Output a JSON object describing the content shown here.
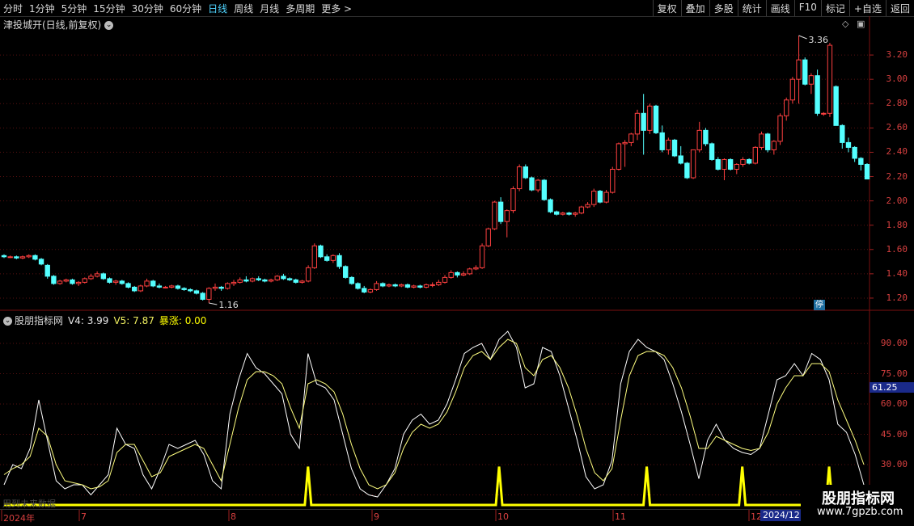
{
  "toolbar": {
    "periods": [
      "分时",
      "1分钟",
      "5分钟",
      "15分钟",
      "30分钟",
      "60分钟",
      "日线",
      "周线",
      "月线",
      "多周期",
      "更多 >"
    ],
    "active_period": "日线",
    "right_buttons": [
      "复权",
      "叠加",
      "多股",
      "统计",
      "画线",
      "F10",
      "标记",
      "+自选",
      "返回"
    ]
  },
  "price_panel": {
    "title": "津投城开(日线,前复权)",
    "y_ticks": [
      "3.20",
      "3.00",
      "2.80",
      "2.60",
      "2.40",
      "2.20",
      "2.00",
      "1.80",
      "1.60",
      "1.40",
      "1.20"
    ],
    "high_label": "3.36",
    "low_label": "1.16",
    "stop_badge": "停"
  },
  "indicator_panel": {
    "title": "股朋指标网",
    "v4_label": "V4: 3.99",
    "v5_label": "V5: 7.87",
    "bz_label": "暴涨: 0.00",
    "y_ticks": [
      "90.00",
      "75.00",
      "60.00",
      "45.00",
      "30.00",
      "15.00"
    ],
    "current_value": "61.25",
    "future_text": "用到未来数据"
  },
  "date_axis": {
    "labels": [
      "2024年",
      "7",
      "8",
      "9",
      "10",
      "11",
      "12"
    ],
    "selected": "2024/12"
  },
  "watermark": {
    "name": "股朋指标网",
    "url": "www.7gpzb.com"
  },
  "colors": {
    "up": "#ff4040",
    "down": "#54ffff",
    "v4": "#ffffff",
    "v5": "#ffff80",
    "bz": "#ffff00",
    "grid": "#5a1010"
  },
  "chart_data": [
    {
      "type": "candlestick",
      "title": "津投城开(日线,前复权)",
      "ylim": [
        1.1,
        3.4
      ],
      "ohlc": [
        [
          1.55,
          1.56,
          1.53,
          1.54
        ],
        [
          1.54,
          1.55,
          1.53,
          1.54
        ],
        [
          1.54,
          1.55,
          1.52,
          1.53
        ],
        [
          1.53,
          1.55,
          1.52,
          1.54
        ],
        [
          1.54,
          1.56,
          1.53,
          1.55
        ],
        [
          1.55,
          1.56,
          1.51,
          1.52
        ],
        [
          1.52,
          1.53,
          1.47,
          1.48
        ],
        [
          1.47,
          1.48,
          1.36,
          1.38
        ],
        [
          1.38,
          1.39,
          1.31,
          1.32
        ],
        [
          1.32,
          1.35,
          1.31,
          1.34
        ],
        [
          1.34,
          1.36,
          1.33,
          1.35
        ],
        [
          1.35,
          1.36,
          1.31,
          1.32
        ],
        [
          1.32,
          1.34,
          1.3,
          1.33
        ],
        [
          1.33,
          1.37,
          1.32,
          1.36
        ],
        [
          1.36,
          1.4,
          1.35,
          1.38
        ],
        [
          1.38,
          1.42,
          1.37,
          1.4
        ],
        [
          1.4,
          1.41,
          1.35,
          1.36
        ],
        [
          1.36,
          1.37,
          1.32,
          1.33
        ],
        [
          1.33,
          1.35,
          1.31,
          1.34
        ],
        [
          1.34,
          1.35,
          1.31,
          1.32
        ],
        [
          1.32,
          1.33,
          1.28,
          1.29
        ],
        [
          1.29,
          1.3,
          1.25,
          1.26
        ],
        [
          1.26,
          1.31,
          1.25,
          1.3
        ],
        [
          1.3,
          1.36,
          1.29,
          1.34
        ],
        [
          1.34,
          1.35,
          1.29,
          1.3
        ],
        [
          1.3,
          1.32,
          1.28,
          1.29
        ],
        [
          1.29,
          1.3,
          1.28,
          1.29
        ],
        [
          1.29,
          1.31,
          1.28,
          1.3
        ],
        [
          1.3,
          1.31,
          1.27,
          1.28
        ],
        [
          1.28,
          1.29,
          1.26,
          1.27
        ],
        [
          1.27,
          1.28,
          1.25,
          1.26
        ],
        [
          1.26,
          1.27,
          1.23,
          1.24
        ],
        [
          1.24,
          1.25,
          1.18,
          1.19
        ],
        [
          1.19,
          1.29,
          1.16,
          1.28
        ],
        [
          1.28,
          1.32,
          1.26,
          1.29
        ],
        [
          1.29,
          1.3,
          1.26,
          1.28
        ],
        [
          1.28,
          1.33,
          1.27,
          1.32
        ],
        [
          1.32,
          1.35,
          1.3,
          1.33
        ],
        [
          1.33,
          1.37,
          1.32,
          1.35
        ],
        [
          1.35,
          1.38,
          1.33,
          1.34
        ],
        [
          1.34,
          1.37,
          1.33,
          1.36
        ],
        [
          1.36,
          1.38,
          1.34,
          1.35
        ],
        [
          1.35,
          1.36,
          1.33,
          1.34
        ],
        [
          1.34,
          1.36,
          1.33,
          1.35
        ],
        [
          1.35,
          1.39,
          1.34,
          1.38
        ],
        [
          1.38,
          1.4,
          1.35,
          1.36
        ],
        [
          1.36,
          1.37,
          1.34,
          1.35
        ],
        [
          1.35,
          1.36,
          1.32,
          1.33
        ],
        [
          1.33,
          1.35,
          1.32,
          1.34
        ],
        [
          1.34,
          1.47,
          1.33,
          1.45
        ],
        [
          1.45,
          1.65,
          1.44,
          1.63
        ],
        [
          1.63,
          1.64,
          1.53,
          1.54
        ],
        [
          1.54,
          1.56,
          1.5,
          1.51
        ],
        [
          1.51,
          1.56,
          1.49,
          1.55
        ],
        [
          1.55,
          1.57,
          1.44,
          1.46
        ],
        [
          1.46,
          1.47,
          1.36,
          1.37
        ],
        [
          1.37,
          1.38,
          1.31,
          1.32
        ],
        [
          1.32,
          1.33,
          1.27,
          1.28
        ],
        [
          1.28,
          1.3,
          1.24,
          1.25
        ],
        [
          1.25,
          1.28,
          1.24,
          1.27
        ],
        [
          1.27,
          1.34,
          1.26,
          1.32
        ],
        [
          1.32,
          1.33,
          1.29,
          1.3
        ],
        [
          1.3,
          1.32,
          1.29,
          1.31
        ],
        [
          1.31,
          1.32,
          1.29,
          1.3
        ],
        [
          1.3,
          1.32,
          1.29,
          1.31
        ],
        [
          1.31,
          1.32,
          1.28,
          1.29
        ],
        [
          1.29,
          1.31,
          1.28,
          1.3
        ],
        [
          1.3,
          1.31,
          1.28,
          1.29
        ],
        [
          1.29,
          1.32,
          1.28,
          1.31
        ],
        [
          1.31,
          1.33,
          1.29,
          1.31
        ],
        [
          1.31,
          1.35,
          1.3,
          1.33
        ],
        [
          1.33,
          1.39,
          1.32,
          1.37
        ],
        [
          1.37,
          1.43,
          1.36,
          1.41
        ],
        [
          1.41,
          1.42,
          1.37,
          1.39
        ],
        [
          1.39,
          1.42,
          1.38,
          1.4
        ],
        [
          1.4,
          1.45,
          1.39,
          1.44
        ],
        [
          1.44,
          1.47,
          1.43,
          1.45
        ],
        [
          1.45,
          1.65,
          1.44,
          1.63
        ],
        [
          1.63,
          1.78,
          1.62,
          1.77
        ],
        [
          1.77,
          2.0,
          1.76,
          1.99
        ],
        [
          1.99,
          2.03,
          1.81,
          1.83
        ],
        [
          1.83,
          1.93,
          1.7,
          1.92
        ],
        [
          1.92,
          2.12,
          1.9,
          2.1
        ],
        [
          2.1,
          2.3,
          2.08,
          2.28
        ],
        [
          2.28,
          2.3,
          2.18,
          2.19
        ],
        [
          2.19,
          2.2,
          2.08,
          2.09
        ],
        [
          2.09,
          2.18,
          2.07,
          2.17
        ],
        [
          2.17,
          2.18,
          2.0,
          2.01
        ],
        [
          2.01,
          2.02,
          1.9,
          1.91
        ],
        [
          1.91,
          1.92,
          1.88,
          1.89
        ],
        [
          1.89,
          1.91,
          1.88,
          1.9
        ],
        [
          1.9,
          1.91,
          1.88,
          1.89
        ],
        [
          1.89,
          1.91,
          1.87,
          1.9
        ],
        [
          1.9,
          1.96,
          1.89,
          1.95
        ],
        [
          1.95,
          1.99,
          1.94,
          1.97
        ],
        [
          1.97,
          2.1,
          1.95,
          2.08
        ],
        [
          2.08,
          2.09,
          1.98,
          1.99
        ],
        [
          1.99,
          2.09,
          1.98,
          2.07
        ],
        [
          2.07,
          2.28,
          2.06,
          2.26
        ],
        [
          2.26,
          2.48,
          2.25,
          2.47
        ],
        [
          2.47,
          2.5,
          2.28,
          2.48
        ],
        [
          2.48,
          2.56,
          2.45,
          2.55
        ],
        [
          2.55,
          2.75,
          2.5,
          2.72
        ],
        [
          2.72,
          2.88,
          2.38,
          2.58
        ],
        [
          2.58,
          2.8,
          2.55,
          2.78
        ],
        [
          2.78,
          2.79,
          2.55,
          2.56
        ],
        [
          2.56,
          2.62,
          2.4,
          2.42
        ],
        [
          2.42,
          2.52,
          2.38,
          2.5
        ],
        [
          2.5,
          2.51,
          2.36,
          2.37
        ],
        [
          2.37,
          2.45,
          2.3,
          2.31
        ],
        [
          2.31,
          2.32,
          2.18,
          2.19
        ],
        [
          2.19,
          2.42,
          2.18,
          2.42
        ],
        [
          2.42,
          2.65,
          2.4,
          2.58
        ],
        [
          2.58,
          2.6,
          2.45,
          2.47
        ],
        [
          2.47,
          2.48,
          2.33,
          2.34
        ],
        [
          2.34,
          2.36,
          2.25,
          2.26
        ],
        [
          2.26,
          2.35,
          2.17,
          2.34
        ],
        [
          2.34,
          2.35,
          2.25,
          2.26
        ],
        [
          2.26,
          2.31,
          2.22,
          2.3
        ],
        [
          2.3,
          2.36,
          2.28,
          2.34
        ],
        [
          2.34,
          2.35,
          2.3,
          2.31
        ],
        [
          2.31,
          2.45,
          2.3,
          2.44
        ],
        [
          2.44,
          2.57,
          2.42,
          2.55
        ],
        [
          2.55,
          2.56,
          2.4,
          2.42
        ],
        [
          2.42,
          2.5,
          2.38,
          2.49
        ],
        [
          2.49,
          2.72,
          2.46,
          2.7
        ],
        [
          2.7,
          2.85,
          2.66,
          2.83
        ],
        [
          2.83,
          3.02,
          2.8,
          3.0
        ],
        [
          3.0,
          3.36,
          2.8,
          3.16
        ],
        [
          3.16,
          3.18,
          2.95,
          2.96
        ],
        [
          2.96,
          3.05,
          2.88,
          3.03
        ],
        [
          3.03,
          3.08,
          2.7,
          2.72
        ],
        [
          2.72,
          2.73,
          2.7,
          2.72
        ],
        [
          2.72,
          3.3,
          2.69,
          3.28
        ],
        [
          2.94,
          2.95,
          2.62,
          2.62
        ],
        [
          2.62,
          2.63,
          2.43,
          2.48
        ],
        [
          2.48,
          2.52,
          2.4,
          2.44
        ],
        [
          2.44,
          2.45,
          2.32,
          2.35
        ],
        [
          2.35,
          2.36,
          2.25,
          2.3
        ],
        [
          2.3,
          2.31,
          2.18,
          2.18
        ]
      ]
    },
    {
      "type": "line",
      "ylim": [
        10,
        100
      ],
      "series": [
        {
          "name": "V4",
          "values": [
            20,
            30,
            28,
            38,
            62,
            42,
            22,
            18,
            20,
            20,
            15,
            20,
            25,
            48,
            40,
            38,
            25,
            18,
            28,
            40,
            38,
            40,
            42,
            35,
            22,
            18,
            55,
            72,
            85,
            78,
            75,
            70,
            65,
            45,
            38,
            85,
            70,
            68,
            62,
            45,
            28,
            18,
            15,
            14,
            20,
            28,
            45,
            52,
            55,
            50,
            52,
            60,
            72,
            85,
            88,
            90,
            82,
            92,
            96,
            88,
            68,
            70,
            88,
            86,
            74,
            58,
            42,
            24,
            18,
            20,
            32,
            70,
            86,
            92,
            88,
            86,
            82,
            70,
            56,
            40,
            23,
            42,
            50,
            42,
            38,
            36,
            35,
            38,
            55,
            72,
            74,
            80,
            74,
            85,
            82,
            72,
            50,
            46,
            35,
            20
          ]
        },
        {
          "name": "V5",
          "values": [
            25,
            28,
            30,
            34,
            48,
            44,
            30,
            22,
            21,
            20,
            18,
            19,
            22,
            36,
            40,
            40,
            32,
            24,
            26,
            34,
            36,
            38,
            40,
            38,
            30,
            22,
            40,
            58,
            72,
            76,
            76,
            74,
            70,
            58,
            48,
            70,
            72,
            70,
            66,
            55,
            40,
            28,
            20,
            18,
            20,
            26,
            38,
            46,
            50,
            48,
            50,
            56,
            66,
            78,
            84,
            86,
            82,
            88,
            92,
            90,
            78,
            74,
            82,
            84,
            78,
            68,
            54,
            38,
            26,
            22,
            28,
            52,
            74,
            84,
            86,
            86,
            84,
            78,
            68,
            54,
            38,
            38,
            44,
            42,
            40,
            38,
            37,
            38,
            46,
            60,
            68,
            74,
            74,
            80,
            80,
            76,
            62,
            52,
            42,
            30
          ]
        },
        {
          "name": "暴涨",
          "values": [
            0,
            0,
            0,
            0,
            0,
            0,
            0,
            0,
            0,
            0,
            0,
            0,
            0,
            0,
            0,
            0,
            0,
            0,
            0,
            0,
            0,
            0,
            0,
            0,
            0,
            0,
            0,
            0,
            0,
            0,
            0,
            0,
            0,
            0,
            0,
            29,
            0,
            0,
            0,
            0,
            0,
            0,
            0,
            0,
            0,
            0,
            0,
            0,
            0,
            0,
            0,
            0,
            0,
            0,
            0,
            0,
            0,
            29,
            0,
            0,
            0,
            0,
            0,
            0,
            0,
            0,
            0,
            0,
            0,
            0,
            0,
            0,
            0,
            0,
            29,
            0,
            0,
            0,
            0,
            0,
            0,
            0,
            0,
            0,
            0,
            29,
            0,
            0,
            0,
            0,
            0,
            0,
            0,
            0,
            0,
            29,
            0,
            0,
            0,
            0
          ]
        }
      ]
    }
  ]
}
